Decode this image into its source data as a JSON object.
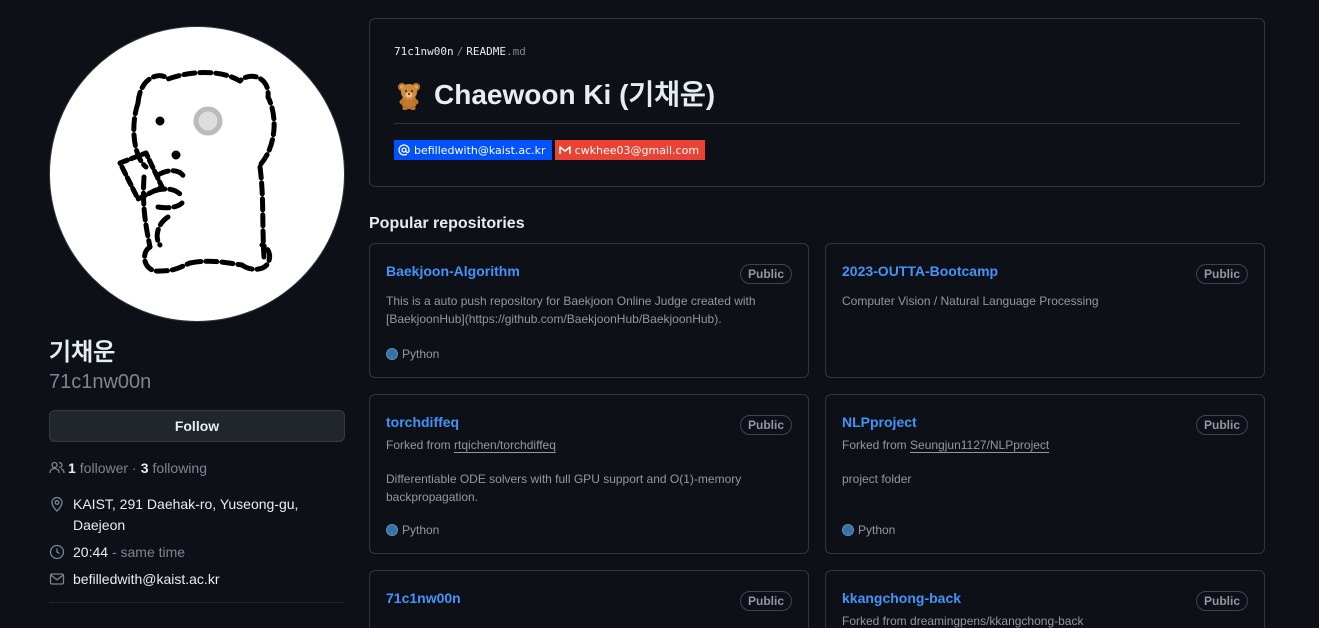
{
  "profile": {
    "display_name": "기채운",
    "login": "71c1nw00n",
    "follow_label": "Follow",
    "followers_count": "1",
    "followers_label": "follower",
    "separator": "·",
    "following_count": "3",
    "following_label": "following",
    "location_line1": "KAIST, 291 Daehak-ro, Yuseong-gu,",
    "location_line2": "Daejeon",
    "local_time": "20:44",
    "time_note": "- same time",
    "email": "befilledwith@kaist.ac.kr"
  },
  "readme": {
    "owner": "71c1nw00n",
    "slash": "/",
    "file_name": "README",
    "file_ext": ".md",
    "title": "Chaewoon Ki (기채운)",
    "emoji_icon": "teddy-bear-icon",
    "badges": [
      {
        "label": "befilledwith@kaist.ac.kr",
        "icon": "at-icon",
        "color": "#0052ff"
      },
      {
        "label": "cwkhee03@gmail.com",
        "icon": "gmail-icon",
        "color": "#ea4335"
      }
    ]
  },
  "popular": {
    "heading": "Popular repositories",
    "repos": [
      {
        "name": "Baekjoon-Algorithm",
        "visibility": "Public",
        "forked_prefix": "",
        "forked_from": "",
        "description_line1": "This is a auto push repository for Baekjoon Online Judge created with",
        "description_line2": "[BaekjoonHub](https://github.com/BaekjoonHub/BaekjoonHub).",
        "language": "Python",
        "language_color": "#3572A5"
      },
      {
        "name": "2023-OUTTA-Bootcamp",
        "visibility": "Public",
        "forked_prefix": "",
        "forked_from": "",
        "description_line1": "Computer Vision / Natural Language Processing",
        "description_line2": "",
        "language": "",
        "language_color": ""
      },
      {
        "name": "torchdiffeq",
        "visibility": "Public",
        "forked_prefix": "Forked from",
        "forked_from": "rtqichen/torchdiffeq",
        "description_line1": "Differentiable ODE solvers with full GPU support and O(1)-memory",
        "description_line2": "backpropagation.",
        "language": "Python",
        "language_color": "#3572A5"
      },
      {
        "name": "NLPproject",
        "visibility": "Public",
        "forked_prefix": "Forked from",
        "forked_from": "Seungjun1127/NLPproject",
        "description_line1": "project folder",
        "description_line2": "",
        "language": "Python",
        "language_color": "#3572A5"
      },
      {
        "name": "71c1nw00n",
        "visibility": "Public",
        "forked_prefix": "",
        "forked_from": "",
        "description_line1": "",
        "description_line2": "",
        "language": "",
        "language_color": ""
      },
      {
        "name": "kkangchong-back",
        "visibility": "Public",
        "forked_prefix": "Forked from",
        "forked_from": "dreamingpens/kkangchong-back",
        "description_line1": "",
        "description_line2": "",
        "language": "",
        "language_color": ""
      }
    ]
  },
  "colors": {
    "background": "#0d1117",
    "border": "#30363d",
    "link": "#4493f8",
    "muted": "#7d8590",
    "text": "#e6edf3"
  }
}
